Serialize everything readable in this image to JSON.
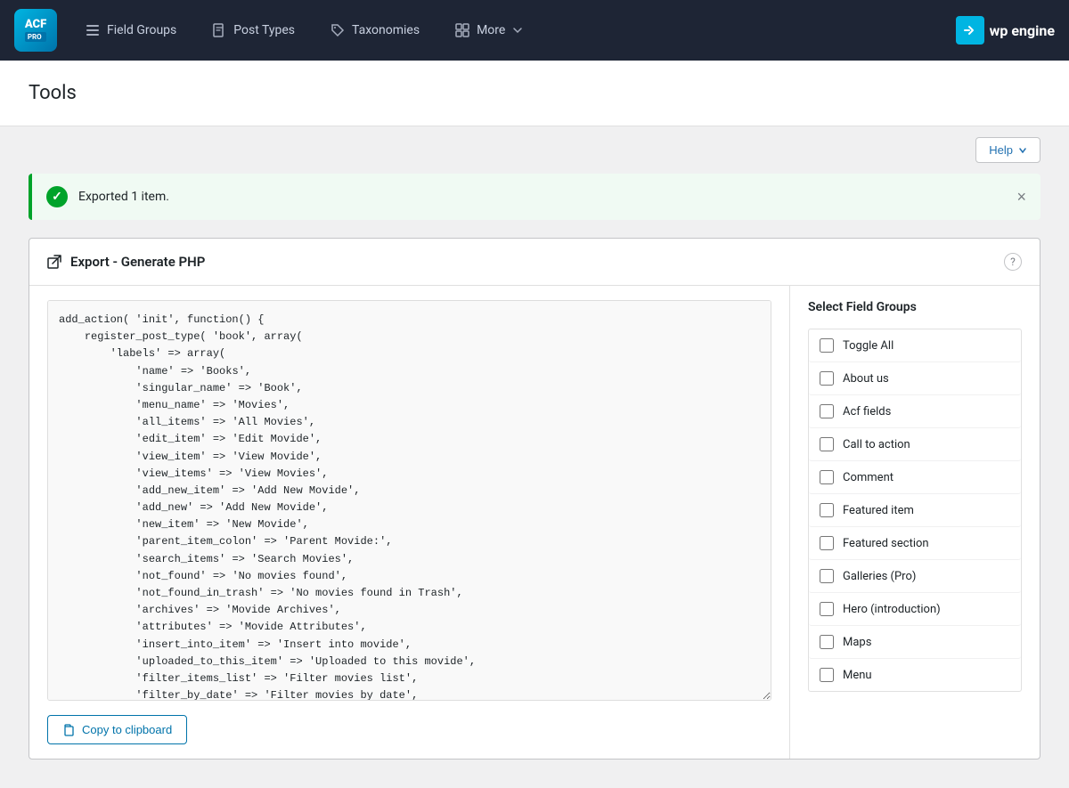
{
  "nav": {
    "logo_text": "ACF",
    "logo_pro": "PRO",
    "items": [
      {
        "id": "field-groups",
        "label": "Field Groups",
        "icon": "list-icon"
      },
      {
        "id": "post-types",
        "label": "Post Types",
        "icon": "document-icon"
      },
      {
        "id": "taxonomies",
        "label": "Taxonomies",
        "icon": "tag-icon"
      },
      {
        "id": "more",
        "label": "More",
        "icon": "grid-icon",
        "has_dropdown": true
      }
    ],
    "wp_engine_label": "WPengine"
  },
  "page": {
    "title": "Tools"
  },
  "help_button": {
    "label": "Help",
    "icon": "chevron-down-icon"
  },
  "notice": {
    "text": "Exported 1 item.",
    "type": "success"
  },
  "export_panel": {
    "title": "Export - Generate PHP",
    "title_icon": "external-link-icon"
  },
  "code": {
    "content": "add_action( 'init', function() {\n    register_post_type( 'book', array(\n        'labels' => array(\n            'name' => 'Books',\n            'singular_name' => 'Book',\n            'menu_name' => 'Movies',\n            'all_items' => 'All Movies',\n            'edit_item' => 'Edit Movide',\n            'view_item' => 'View Movide',\n            'view_items' => 'View Movies',\n            'add_new_item' => 'Add New Movide',\n            'add_new' => 'Add New Movide',\n            'new_item' => 'New Movide',\n            'parent_item_colon' => 'Parent Movide:',\n            'search_items' => 'Search Movies',\n            'not_found' => 'No movies found',\n            'not_found_in_trash' => 'No movies found in Trash',\n            'archives' => 'Movide Archives',\n            'attributes' => 'Movide Attributes',\n            'insert_into_item' => 'Insert into movide',\n            'uploaded_to_this_item' => 'Uploaded to this movide',\n            'filter_items_list' => 'Filter movies list',\n            'filter_by_date' => 'Filter movies by date',\n            'items_list_navigation' => 'Movies list navigation',\n            'items_list' => 'Movies list',\n            'item_published' => 'Movide published',\n            'item_published_privately' => 'Movide published privately',"
  },
  "copy_button": {
    "label": "Copy to clipboard"
  },
  "sidebar": {
    "title": "Select Field Groups",
    "items": [
      {
        "id": "toggle-all",
        "label": "Toggle All",
        "checked": false
      },
      {
        "id": "about-us",
        "label": "About us",
        "checked": false
      },
      {
        "id": "acf-fields",
        "label": "Acf fields",
        "checked": false
      },
      {
        "id": "call-to-action",
        "label": "Call to action",
        "checked": false
      },
      {
        "id": "comment",
        "label": "Comment",
        "checked": false
      },
      {
        "id": "featured-item",
        "label": "Featured item",
        "checked": false
      },
      {
        "id": "featured-section",
        "label": "Featured section",
        "checked": false
      },
      {
        "id": "galleries-pro",
        "label": "Galleries (Pro)",
        "checked": false
      },
      {
        "id": "hero-introduction",
        "label": "Hero (introduction)",
        "checked": false
      },
      {
        "id": "maps",
        "label": "Maps",
        "checked": false
      },
      {
        "id": "menu",
        "label": "Menu",
        "checked": false
      }
    ]
  }
}
